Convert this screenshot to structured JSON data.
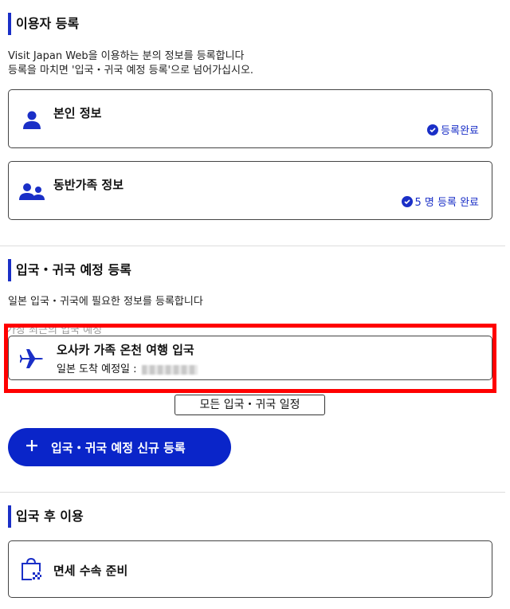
{
  "user_section": {
    "title": "이용자 등록",
    "desc_line1": "Visit Japan Web을 이용하는 분의 정보를 등록합니다",
    "desc_line2": "등록을 마치면 '입국・귀국 예정 등록'으로 넘어가십시오.",
    "personal_card": {
      "title": "본인 정보",
      "status": "등록완료",
      "icon": "person-icon"
    },
    "family_card": {
      "title": "동반가족 정보",
      "status": "5 명 등록 완료",
      "icon": "family-icon"
    }
  },
  "entry_section": {
    "title": "입국・귀국 예정 등록",
    "desc": "일본 입국・귀국에 필요한 정보를 등록합니다",
    "recent_label": "가장 최근의 입국 예정",
    "trip_card": {
      "title": "오사카 가족 온천 여행 입국",
      "arrival_label": "일본 도착 예정일 :",
      "icon": "airplane-icon"
    },
    "all_trips_button": "모든 입국・귀국 일정",
    "new_button": "입국・귀국 예정 신규 등록"
  },
  "after_section": {
    "title": "입국 후 이용",
    "duty_free_card": {
      "title": "면세 수속 준비",
      "icon": "shopping-bag-icon"
    }
  },
  "colors": {
    "accent": "#1a2fc7",
    "highlight": "#ff0000"
  }
}
